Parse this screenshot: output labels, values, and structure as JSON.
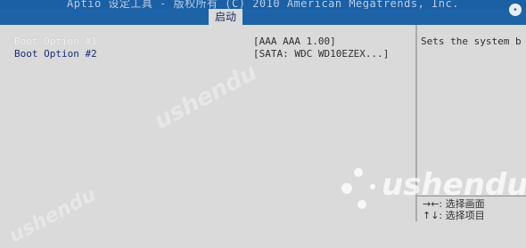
{
  "header": {
    "title": "Aptio 设定工具 - 版权所有 (C) 2010 American Megatrends, Inc.",
    "active_tab": "启动"
  },
  "boot_options": [
    {
      "label": "Boot Option #1",
      "value": "[AAA AAA 1.00]",
      "selected": true
    },
    {
      "label": "Boot Option #2",
      "value": "[SATA: WDC WD10EZEX...]",
      "selected": false
    }
  ],
  "help_panel": {
    "description": "Sets the system b",
    "key_hints": [
      "→←: 选择画面",
      "↑↓: 选择项目"
    ]
  },
  "watermark": {
    "text": "ushendu"
  },
  "colors": {
    "header_blue": "#1b5fa4",
    "background": "#d9dad9",
    "option_label_blue": "#1e2d75",
    "selected_text": "#f4f4f4"
  }
}
